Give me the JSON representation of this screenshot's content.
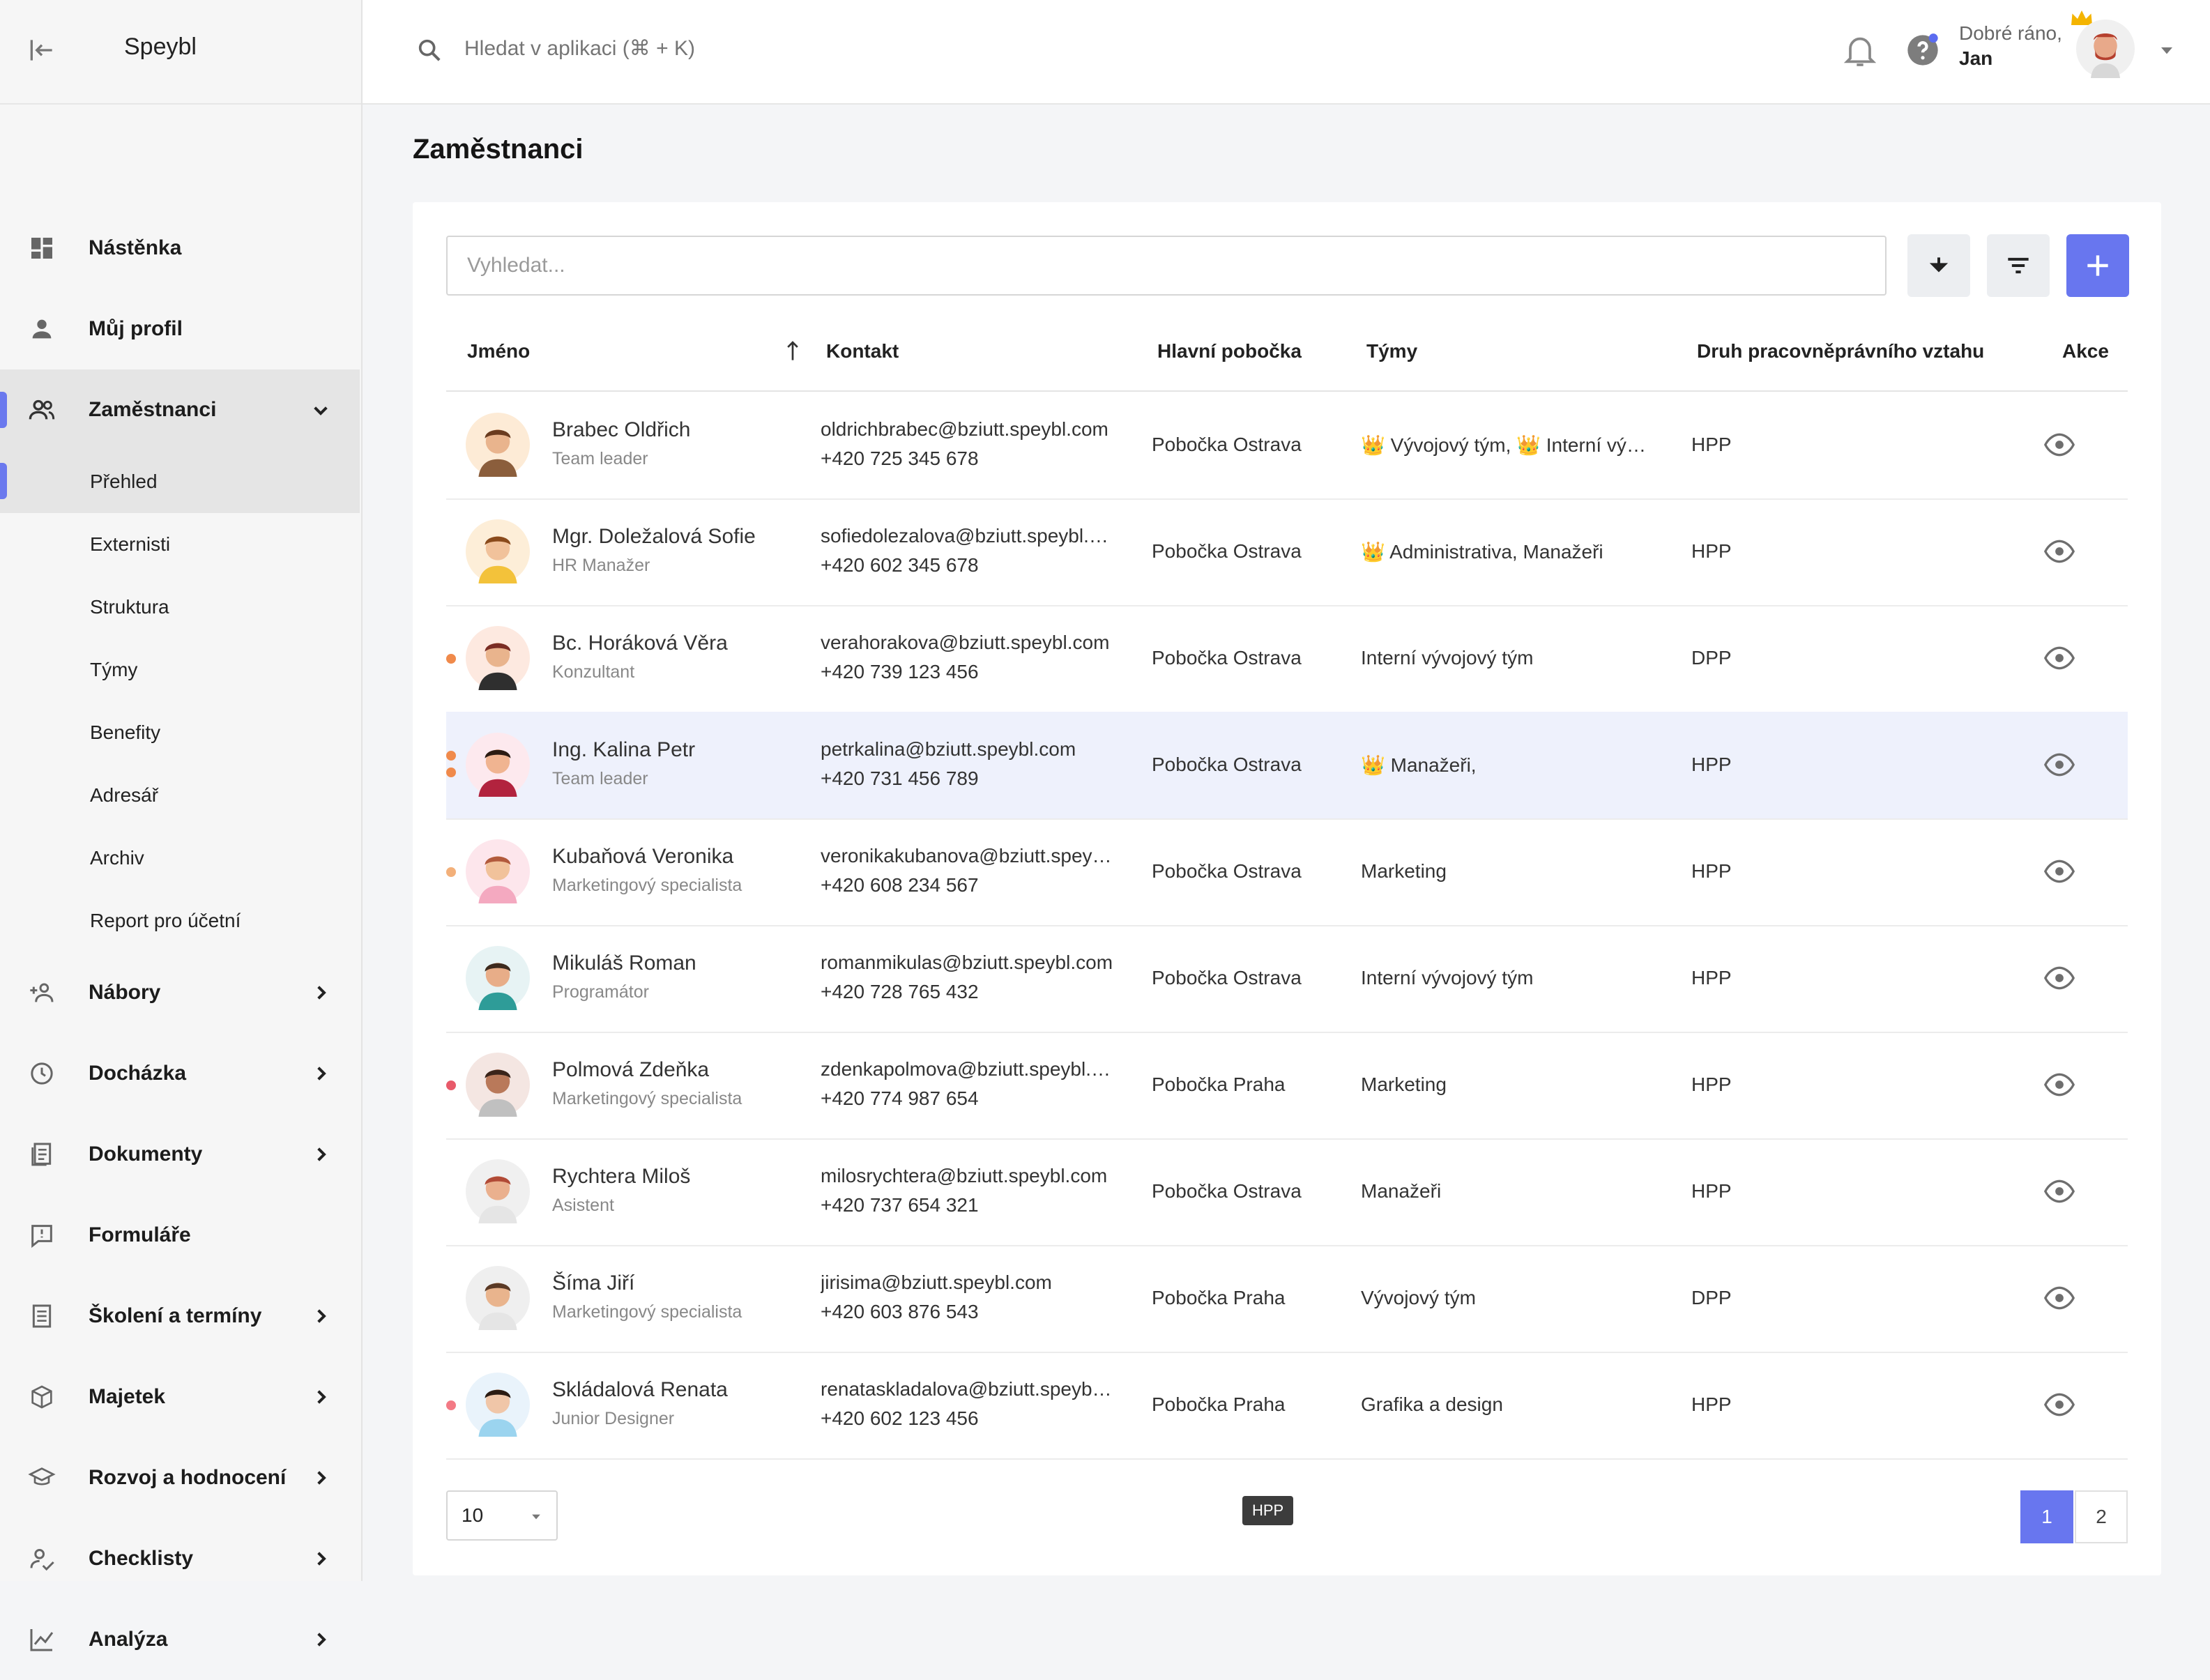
{
  "app": {
    "brand": "Speybl"
  },
  "search": {
    "placeholder": "Hledat v aplikaci (⌘ + K)"
  },
  "user": {
    "greeting": "Dobré ráno,",
    "name": "Jan"
  },
  "sidebar": {
    "items": [
      {
        "label": "Nástěnka",
        "icon": "dashboard-icon"
      },
      {
        "label": "Můj profil",
        "icon": "person-icon"
      },
      {
        "label": "Zaměstnanci",
        "icon": "people-icon"
      },
      {
        "label": "Nábory",
        "icon": "recruit-icon"
      },
      {
        "label": "Docházka",
        "icon": "clock-icon"
      },
      {
        "label": "Dokumenty",
        "icon": "documents-icon"
      },
      {
        "label": "Formuláře",
        "icon": "form-icon"
      },
      {
        "label": "Školení a termíny",
        "icon": "training-icon"
      },
      {
        "label": "Majetek",
        "icon": "box-icon"
      },
      {
        "label": "Rozvoj a hodnocení",
        "icon": "graduation-icon"
      },
      {
        "label": "Checklisty",
        "icon": "checklist-icon"
      },
      {
        "label": "Analýza",
        "icon": "chart-icon"
      }
    ],
    "subitems": [
      "Přehled",
      "Externisti",
      "Struktura",
      "Týmy",
      "Benefity",
      "Adresář",
      "Archiv",
      "Report pro účetní"
    ]
  },
  "page": {
    "title": "Zaměstnanci"
  },
  "table": {
    "search_placeholder": "Vyhledat...",
    "columns": {
      "name": "Jméno",
      "contact": "Kontakt",
      "branch": "Hlavní pobočka",
      "teams": "Týmy",
      "relation": "Druh pracovněprávního vztahu",
      "actions": "Akce"
    },
    "rows": [
      {
        "name": "Brabec Oldřich",
        "role": "Team leader",
        "email": "oldrichbrabec@bziutt.speybl.com",
        "phone": "+420 725 345 678",
        "branch": "Pobočka Ostrava",
        "teams": "👑 Vývojový tým, 👑 Interní vývojový tým",
        "relation": "HPP"
      },
      {
        "name": "Mgr. Doležalová Sofie",
        "role": "HR Manažer",
        "email": "sofiedolezalova@bziutt.speybl.com",
        "phone": "+420 602 345 678",
        "branch": "Pobočka Ostrava",
        "teams": "👑 Administrativa, Manažeři",
        "relation": "HPP"
      },
      {
        "name": "Bc. Horáková Věra",
        "role": "Konzultant",
        "email": "verahorakova@bziutt.speybl.com",
        "phone": "+420 739 123 456",
        "branch": "Pobočka Ostrava",
        "teams": "Interní vývojový tým",
        "relation": "DPP"
      },
      {
        "name": "Ing. Kalina Petr",
        "role": "Team leader",
        "email": "petrkalina@bziutt.speybl.com",
        "phone": "+420 731 456 789",
        "branch": "Pobočka Ostrava",
        "teams": "👑 Manažeři,",
        "relation": "HPP"
      },
      {
        "name": "Kubaňová Veronika",
        "role": "Marketingový specialista",
        "email": "veronikakubanova@bziutt.speybl.com",
        "phone": "+420 608 234 567",
        "branch": "Pobočka Ostrava",
        "teams": "Marketing",
        "relation": "HPP"
      },
      {
        "name": "Mikuláš Roman",
        "role": "Programátor",
        "email": "romanmikulas@bziutt.speybl.com",
        "phone": "+420 728 765 432",
        "branch": "Pobočka Ostrava",
        "teams": "Interní vývojový tým",
        "relation": "HPP"
      },
      {
        "name": "Polmová Zdeňka",
        "role": "Marketingový specialista",
        "email": "zdenkapolmova@bziutt.speybl.com",
        "phone": "+420 774 987 654",
        "branch": "Pobočka Praha",
        "teams": "Marketing",
        "relation": "HPP"
      },
      {
        "name": "Rychtera Miloš",
        "role": "Asistent",
        "email": "milosrychtera@bziutt.speybl.com",
        "phone": "+420 737 654 321",
        "branch": "Pobočka Ostrava",
        "teams": "Manažeři",
        "relation": "HPP"
      },
      {
        "name": "Šíma Jiří",
        "role": "Marketingový specialista",
        "email": "jirisima@bziutt.speybl.com",
        "phone": "+420 603 876 543",
        "branch": "Pobočka Praha",
        "teams": "Vývojový tým",
        "relation": "DPP"
      },
      {
        "name": "Skládalová Renata",
        "role": "Junior Designer",
        "email": "renataskladalova@bziutt.speybl.com",
        "phone": "+420 602 123 456",
        "branch": "Pobočka Praha",
        "teams": "Grafika a design",
        "relation": "HPP"
      }
    ]
  },
  "pagination": {
    "per_page": "10",
    "tooltip": "HPP",
    "pages": [
      "1",
      "2"
    ]
  },
  "colors": {
    "accent": "#6876ef",
    "highlight_row": "#eef1fc"
  }
}
